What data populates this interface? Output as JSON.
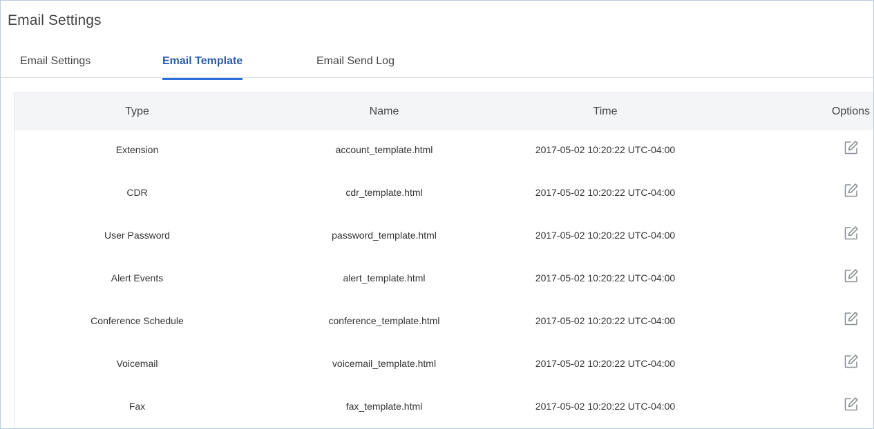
{
  "page": {
    "title": "Email Settings"
  },
  "tabs": [
    {
      "label": "Email Settings",
      "active": false
    },
    {
      "label": "Email Template",
      "active": true
    },
    {
      "label": "Email Send Log",
      "active": false
    }
  ],
  "table": {
    "columns": [
      "Type",
      "Name",
      "Time",
      "Options"
    ],
    "rows": [
      {
        "type": "Extension",
        "name": "account_template.html",
        "time": "2017-05-02 10:20:22 UTC-04:00",
        "icon": "edit-icon"
      },
      {
        "type": "CDR",
        "name": "cdr_template.html",
        "time": "2017-05-02 10:20:22 UTC-04:00",
        "icon": "edit-icon"
      },
      {
        "type": "User Password",
        "name": "password_template.html",
        "time": "2017-05-02 10:20:22 UTC-04:00",
        "icon": "edit-icon"
      },
      {
        "type": "Alert Events",
        "name": "alert_template.html",
        "time": "2017-05-02 10:20:22 UTC-04:00",
        "icon": "edit-icon"
      },
      {
        "type": "Conference Schedule",
        "name": "conference_template.html",
        "time": "2017-05-02 10:20:22 UTC-04:00",
        "icon": "edit-icon"
      },
      {
        "type": "Voicemail",
        "name": "voicemail_template.html",
        "time": "2017-05-02 10:20:22 UTC-04:00",
        "icon": "edit-icon"
      },
      {
        "type": "Fax",
        "name": "fax_template.html",
        "time": "2017-05-02 10:20:22 UTC-04:00",
        "icon": "edit-icon"
      }
    ]
  },
  "colors": {
    "accent": "#2b6fd6",
    "active_tab_text": "#2b5ca8",
    "header_bg": "#f4f5f7",
    "frame_border": "#b9cde3",
    "icon": "#8a8f96"
  }
}
